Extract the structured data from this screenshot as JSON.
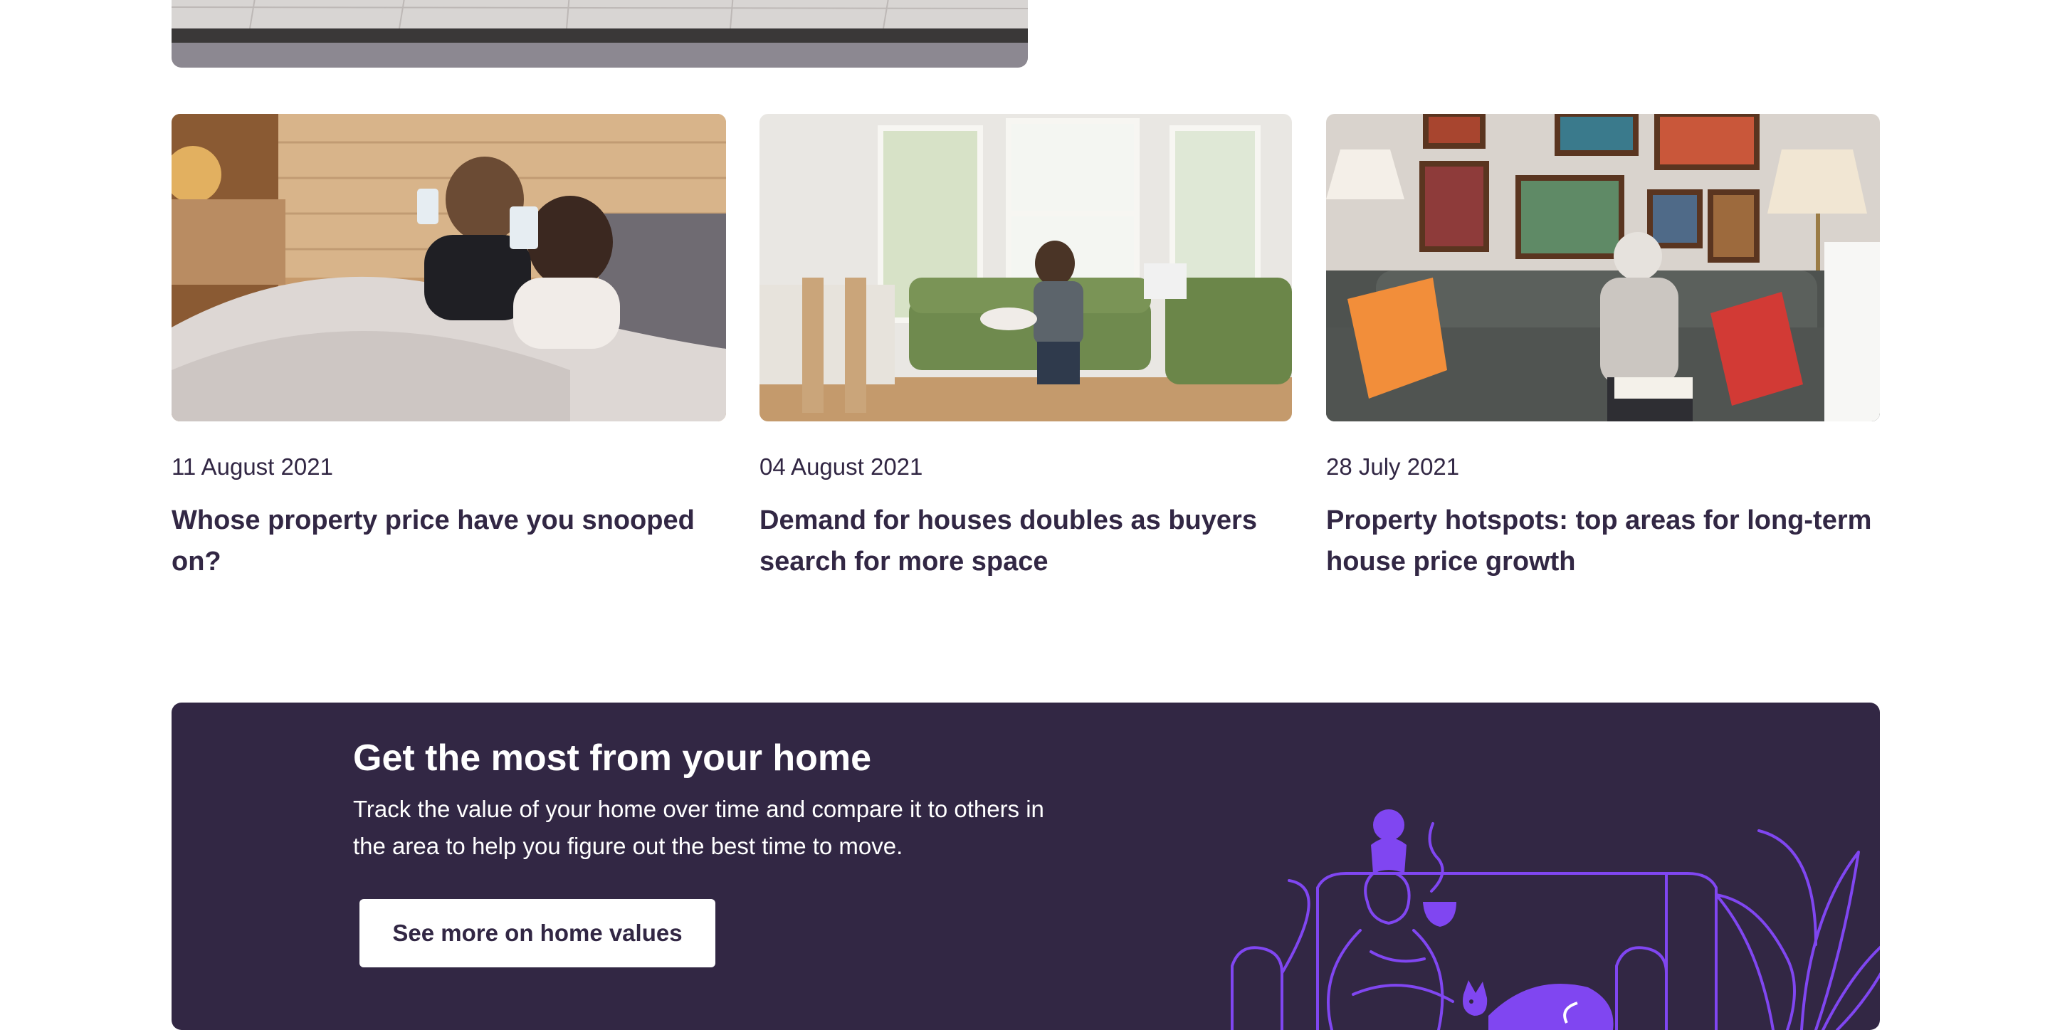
{
  "articles": [
    {
      "date": "11 August 2021",
      "title": "Whose property price have you snooped on?"
    },
    {
      "date": "04 August 2021",
      "title": "Demand for houses doubles as buyers search for more space"
    },
    {
      "date": "28 July 2021",
      "title": "Property hotspots: top areas for long-term house price growth"
    }
  ],
  "promo": {
    "title": "Get the most from your home",
    "text": "Track the value of your home over time and compare it to others in the area to help you figure out the best time to move.",
    "button_label": "See more on home values"
  },
  "colors": {
    "brand_dark": "#322744",
    "accent_purple": "#8046F1",
    "background": "#FFFFFF"
  }
}
